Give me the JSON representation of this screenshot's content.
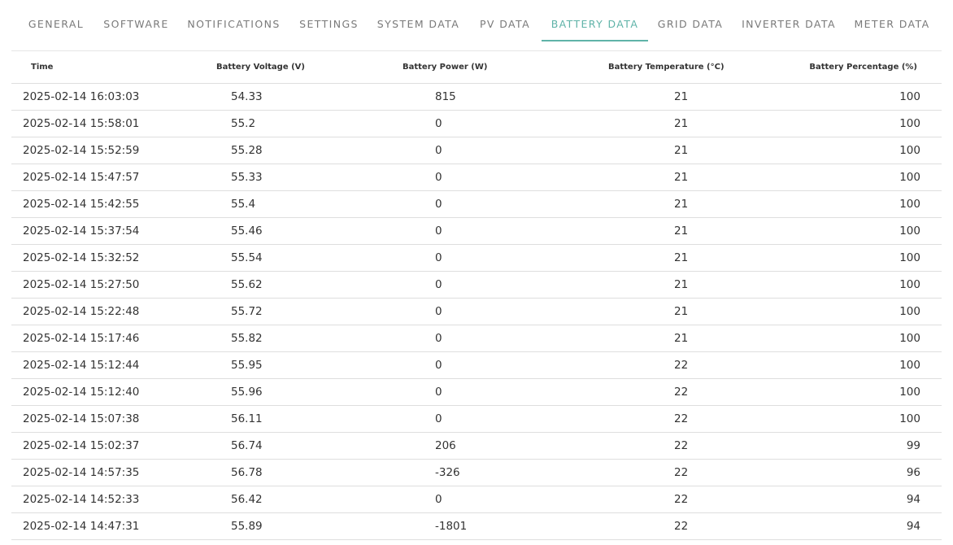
{
  "tabs": [
    {
      "label": "GENERAL",
      "active": false
    },
    {
      "label": "SOFTWARE",
      "active": false
    },
    {
      "label": "NOTIFICATIONS",
      "active": false
    },
    {
      "label": "SETTINGS",
      "active": false
    },
    {
      "label": "SYSTEM DATA",
      "active": false
    },
    {
      "label": "PV DATA",
      "active": false
    },
    {
      "label": "BATTERY DATA",
      "active": true
    },
    {
      "label": "GRID DATA",
      "active": false
    },
    {
      "label": "INVERTER DATA",
      "active": false
    },
    {
      "label": "METER DATA",
      "active": false
    }
  ],
  "colors": {
    "accent": "#5fb3a8",
    "tab_text": "#7a7a7a",
    "text": "#333333",
    "divider": "#dedede"
  },
  "table": {
    "headers": {
      "time": "Time",
      "voltage": "Battery Voltage (V)",
      "power": "Battery Power (W)",
      "temperature": "Battery Temperature (°C)",
      "percentage": "Battery Percentage (%)"
    },
    "rows": [
      [
        "2025-02-14 16:03:03",
        "54.33",
        "815",
        "21",
        "100"
      ],
      [
        "2025-02-14 15:58:01",
        "55.2",
        "0",
        "21",
        "100"
      ],
      [
        "2025-02-14 15:52:59",
        "55.28",
        "0",
        "21",
        "100"
      ],
      [
        "2025-02-14 15:47:57",
        "55.33",
        "0",
        "21",
        "100"
      ],
      [
        "2025-02-14 15:42:55",
        "55.4",
        "0",
        "21",
        "100"
      ],
      [
        "2025-02-14 15:37:54",
        "55.46",
        "0",
        "21",
        "100"
      ],
      [
        "2025-02-14 15:32:52",
        "55.54",
        "0",
        "21",
        "100"
      ],
      [
        "2025-02-14 15:27:50",
        "55.62",
        "0",
        "21",
        "100"
      ],
      [
        "2025-02-14 15:22:48",
        "55.72",
        "0",
        "21",
        "100"
      ],
      [
        "2025-02-14 15:17:46",
        "55.82",
        "0",
        "21",
        "100"
      ],
      [
        "2025-02-14 15:12:44",
        "55.95",
        "0",
        "22",
        "100"
      ],
      [
        "2025-02-14 15:12:40",
        "55.96",
        "0",
        "22",
        "100"
      ],
      [
        "2025-02-14 15:07:38",
        "56.11",
        "0",
        "22",
        "100"
      ],
      [
        "2025-02-14 15:02:37",
        "56.74",
        "206",
        "22",
        "99"
      ],
      [
        "2025-02-14 14:57:35",
        "56.78",
        "-326",
        "22",
        "96"
      ],
      [
        "2025-02-14 14:52:33",
        "56.42",
        "0",
        "22",
        "94"
      ],
      [
        "2025-02-14 14:47:31",
        "55.89",
        "-1801",
        "22",
        "94"
      ]
    ]
  }
}
